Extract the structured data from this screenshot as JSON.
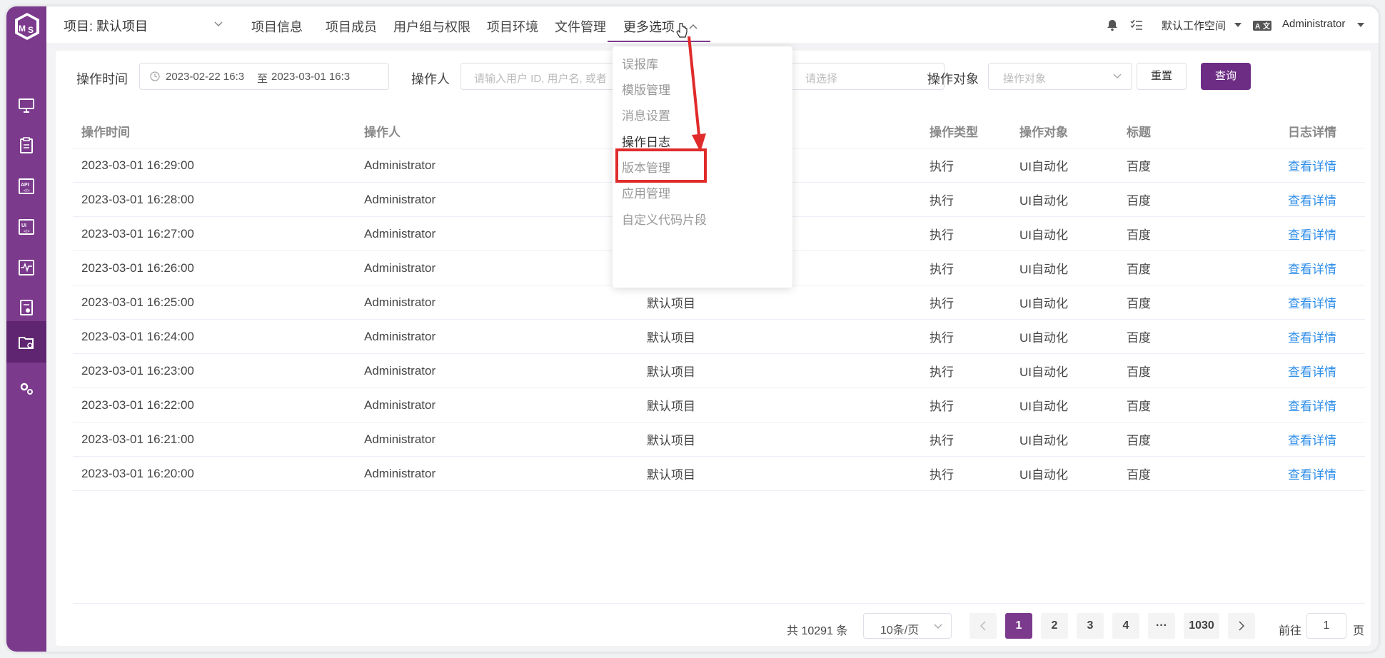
{
  "topbar": {
    "project_label": "项目: 默认项目",
    "nav": [
      "项目信息",
      "项目成员",
      "用户组与权限",
      "项目环境",
      "文件管理",
      "更多选项"
    ],
    "workspace": "默认工作空间",
    "user": "Administrator"
  },
  "filters": {
    "time_label": "操作时间",
    "time_start": "2023-02-22 16:3",
    "time_sep": "至",
    "time_end": "2023-03-01 16:3",
    "operator_label": "操作人",
    "operator_placeholder": "请输入用户 ID, 用户名, 或者",
    "type_placeholder": "请选择",
    "object_label": "操作对象",
    "object_placeholder": "操作对象",
    "reset": "重置",
    "query": "查询"
  },
  "table": {
    "headers": [
      "操作时间",
      "操作人",
      "",
      "操作类型",
      "操作对象",
      "标题",
      "日志详情"
    ],
    "rows": [
      {
        "time": "2023-03-01 16:29:00",
        "operator": "Administrator",
        "project": "",
        "type": "执行",
        "object": "UI自动化",
        "title": "百度",
        "detail": "查看详情"
      },
      {
        "time": "2023-03-01 16:28:00",
        "operator": "Administrator",
        "project": "",
        "type": "执行",
        "object": "UI自动化",
        "title": "百度",
        "detail": "查看详情"
      },
      {
        "time": "2023-03-01 16:27:00",
        "operator": "Administrator",
        "project": "",
        "type": "执行",
        "object": "UI自动化",
        "title": "百度",
        "detail": "查看详情"
      },
      {
        "time": "2023-03-01 16:26:00",
        "operator": "Administrator",
        "project": "",
        "type": "执行",
        "object": "UI自动化",
        "title": "百度",
        "detail": "查看详情"
      },
      {
        "time": "2023-03-01 16:25:00",
        "operator": "Administrator",
        "project": "默认项目",
        "type": "执行",
        "object": "UI自动化",
        "title": "百度",
        "detail": "查看详情"
      },
      {
        "time": "2023-03-01 16:24:00",
        "operator": "Administrator",
        "project": "默认项目",
        "type": "执行",
        "object": "UI自动化",
        "title": "百度",
        "detail": "查看详情"
      },
      {
        "time": "2023-03-01 16:23:00",
        "operator": "Administrator",
        "project": "默认项目",
        "type": "执行",
        "object": "UI自动化",
        "title": "百度",
        "detail": "查看详情"
      },
      {
        "time": "2023-03-01 16:22:00",
        "operator": "Administrator",
        "project": "默认项目",
        "type": "执行",
        "object": "UI自动化",
        "title": "百度",
        "detail": "查看详情"
      },
      {
        "time": "2023-03-01 16:21:00",
        "operator": "Administrator",
        "project": "默认项目",
        "type": "执行",
        "object": "UI自动化",
        "title": "百度",
        "detail": "查看详情"
      },
      {
        "time": "2023-03-01 16:20:00",
        "operator": "Administrator",
        "project": "默认项目",
        "type": "执行",
        "object": "UI自动化",
        "title": "百度",
        "detail": "查看详情"
      }
    ]
  },
  "pagination": {
    "total": "共 10291 条",
    "page_size": "10条/页",
    "pages": [
      "1",
      "2",
      "3",
      "4",
      "1030"
    ],
    "ellipsis": "···",
    "current": "1",
    "goto_label": "前往",
    "goto_value": "1",
    "page_suffix": "页"
  },
  "dropdown": {
    "items": [
      "误报库",
      "模版管理",
      "消息设置",
      "操作日志",
      "版本管理",
      "应用管理",
      "自定义代码片段"
    ],
    "highlighted": "操作日志"
  },
  "colors": {
    "brand": "#7b3a8c",
    "brand_dark": "#5f2570",
    "query_button": "#6d2d85",
    "link": "#2f8ee8",
    "annotation": "#e02b2b"
  }
}
